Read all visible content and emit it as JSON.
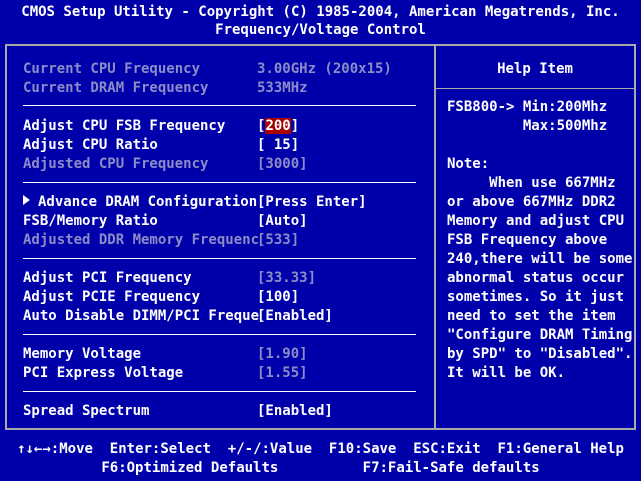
{
  "header": {
    "title": "CMOS Setup Utility - Copyright (C) 1985-2004, American Megatrends, Inc.",
    "subtitle": "Frequency/Voltage Control"
  },
  "info": [
    {
      "label": "Current CPU Frequency",
      "value": "3.00GHz (200x15)"
    },
    {
      "label": "Current DRAM Frequency",
      "value": "533MHz"
    }
  ],
  "settings": {
    "cpu_fsb": {
      "label": "Adjust CPU FSB Frequency",
      "open": "[",
      "value": "200",
      "close": "]"
    },
    "cpu_ratio": {
      "label": "Adjust CPU Ratio",
      "value": "[ 15]"
    },
    "adjusted_cpu": {
      "label": "Adjusted CPU Frequency",
      "value": "[3000]"
    },
    "advance_dram": {
      "label": "Advance DRAM Configuration",
      "value": "[Press Enter]"
    },
    "fsb_mem_ratio": {
      "label": "FSB/Memory Ratio",
      "value": "[Auto]"
    },
    "adjusted_ddr": {
      "label": "Adjusted DDR Memory Frequenc",
      "value": "[533]"
    },
    "pci_freq": {
      "label": "Adjust PCI Frequency",
      "value": "[33.33]"
    },
    "pcie_freq": {
      "label": "Adjust PCIE Frequency",
      "value": "[100]"
    },
    "auto_disable": {
      "label": "Auto Disable DIMM/PCI Freque",
      "value": "[Enabled]"
    },
    "mem_voltage": {
      "label": "Memory Voltage",
      "value": "[1.90]"
    },
    "pcie_voltage": {
      "label": "PCI Express Voltage",
      "value": "[1.55]"
    },
    "spread": {
      "label": "Spread Spectrum",
      "value": "[Enabled]"
    }
  },
  "help": {
    "title": "Help Item",
    "fsb_line1": "FSB800-> Min:200Mhz",
    "fsb_line2": "         Max:500Mhz",
    "note_lines": [
      "Note:",
      "     When use 667MHz",
      "or above 667MHz DDR2",
      "Memory and adjust CPU",
      "FSB Frequency above",
      "240,there will be some",
      "abnormal status occur",
      "sometimes. So it just",
      "need to set the item",
      "\"Configure DRAM Timing",
      "by SPD\" to \"Disabled\".",
      "It will be OK."
    ]
  },
  "footer": {
    "line1": "↑↓←→:Move  Enter:Select  +/-/:Value  F10:Save  ESC:Exit  F1:General Help",
    "line2": "F6:Optimized Defaults          F7:Fail-Safe defaults"
  }
}
